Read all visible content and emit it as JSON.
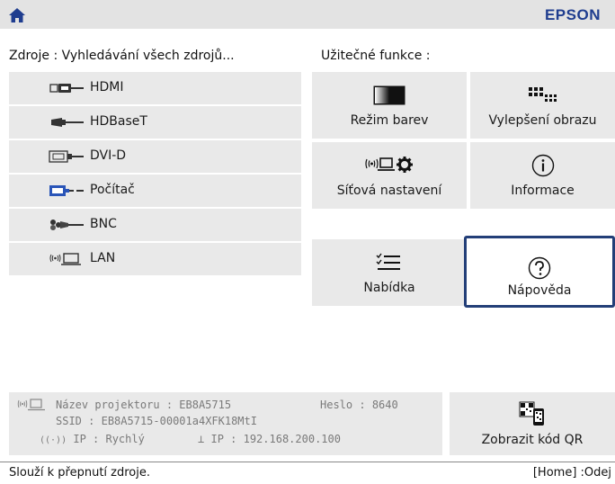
{
  "header": {
    "brand": "EPSON",
    "home_icon": "home-icon"
  },
  "sources": {
    "title": "Zdroje : Vyhledávání všech zdrojů...",
    "items": [
      {
        "label": "HDMI",
        "icon": "hdmi-icon"
      },
      {
        "label": "HDBaseT",
        "icon": "hdbaset-icon"
      },
      {
        "label": "DVI-D",
        "icon": "dvi-icon"
      },
      {
        "label": "Počítač",
        "icon": "computer-icon"
      },
      {
        "label": "BNC",
        "icon": "bnc-icon"
      },
      {
        "label": "LAN",
        "icon": "lan-icon"
      }
    ]
  },
  "functions": {
    "title": "Užitečné funkce :",
    "tiles": [
      {
        "label": "Režim barev",
        "icon": "color-mode-icon"
      },
      {
        "label": "Vylepšení obrazu",
        "icon": "image-enhancement-icon"
      },
      {
        "label": "Síťová nastavení",
        "icon": "network-settings-icon"
      },
      {
        "label": "Informace",
        "icon": "info-icon"
      },
      {
        "label": "Nabídka",
        "icon": "menu-icon"
      },
      {
        "label": "Nápověda",
        "icon": "help-icon",
        "selected": true
      }
    ]
  },
  "network_info": {
    "projector_name_label": "Název projektoru :",
    "projector_name": "EB8A5715",
    "password_label": "Heslo :",
    "password": "8640",
    "ssid_label": "SSID :",
    "ssid": "EB8A5715-00001a4XFK18MtI",
    "ip_label": "IP :",
    "ip_mode": "Rychlý",
    "wired_ip_label": "IP :",
    "wired_ip": "192.168.200.100"
  },
  "qr": {
    "label": "Zobrazit kód QR",
    "icon": "qr-code-icon"
  },
  "status_bar": {
    "hint": "Slouží k přepnutí zdroje.",
    "home_hint": "[Home] :Odej"
  },
  "colors": {
    "brand": "#1f3d8f",
    "tile_bg": "#e9e9e9",
    "focus_border": "#233f78"
  }
}
